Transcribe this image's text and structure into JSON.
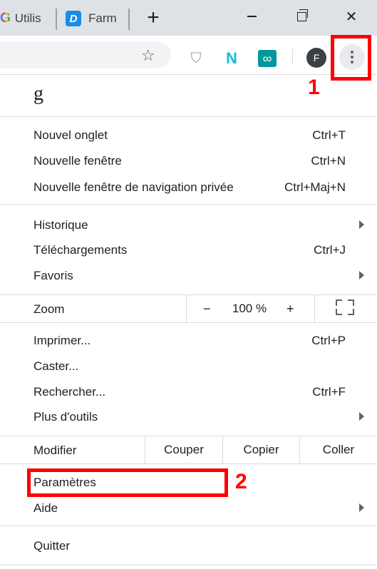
{
  "tabs": [
    {
      "label": "Utilis",
      "icon": "google-g-icon",
      "icon_glyph": "G"
    },
    {
      "label": "Farm",
      "icon": "d-app-icon",
      "icon_glyph": "D"
    }
  ],
  "new_tab_glyph": "+",
  "window_controls": {
    "close_glyph": "✕"
  },
  "toolbar": {
    "bookmark_glyph": "☆",
    "ext_shield_glyph": "⛉",
    "ext_n_glyph": "N",
    "ext_inf_glyph": "∞",
    "avatar_letter": "F"
  },
  "annotations": {
    "marker1": "1",
    "marker2": "2"
  },
  "colors": {
    "highlight": "#ff0000",
    "menu_bg": "#ffffff",
    "tabstrip_bg": "#dee1e6"
  },
  "menu": {
    "profile_initial": "g",
    "items": {
      "new_tab": {
        "label": "Nouvel onglet",
        "shortcut": "Ctrl+T"
      },
      "new_window": {
        "label": "Nouvelle fenêtre",
        "shortcut": "Ctrl+N"
      },
      "incognito": {
        "label": "Nouvelle fenêtre de navigation privée",
        "shortcut": "Ctrl+Maj+N"
      },
      "history": {
        "label": "Historique"
      },
      "downloads": {
        "label": "Téléchargements",
        "shortcut": "Ctrl+J"
      },
      "bookmarks": {
        "label": "Favoris"
      },
      "print": {
        "label": "Imprimer...",
        "shortcut": "Ctrl+P"
      },
      "cast": {
        "label": "Caster..."
      },
      "find": {
        "label": "Rechercher...",
        "shortcut": "Ctrl+F"
      },
      "more_tools": {
        "label": "Plus d'outils"
      },
      "settings": {
        "label": "Paramètres"
      },
      "help": {
        "label": "Aide"
      },
      "quit": {
        "label": "Quitter"
      }
    },
    "zoom": {
      "label": "Zoom",
      "minus": "−",
      "value": "100 %",
      "plus": "+"
    },
    "edit": {
      "label": "Modifier",
      "cut": "Couper",
      "copy": "Copier",
      "paste": "Coller"
    }
  }
}
